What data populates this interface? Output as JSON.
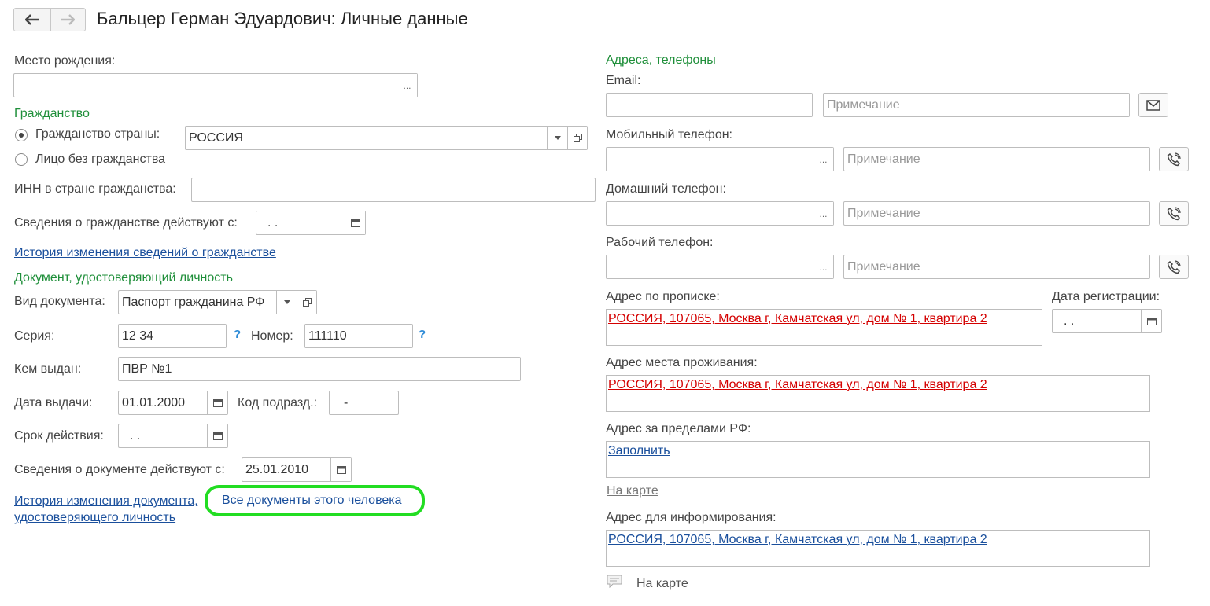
{
  "header": {
    "title": "Бальцер Герман Эдуардович: Личные данные"
  },
  "left": {
    "birthplace": {
      "label": "Место рождения:",
      "value": "",
      "select_btn": "..."
    },
    "citizenship_group": "Гражданство",
    "citizenship": {
      "option_country": "Гражданство страны:",
      "option_none": "Лицо без гражданства",
      "country_value": "РОССИЯ"
    },
    "inn": {
      "label": "ИНН в стране гражданства:",
      "value": ""
    },
    "citizenship_since": {
      "label": "Сведения о гражданстве действуют с:",
      "value": " .  ."
    },
    "citizenship_history_link": "История изменения сведений о гражданстве",
    "doc_group": "Документ, удостоверяющий личность",
    "doc_type": {
      "label": "Вид документа:",
      "value": "Паспорт гражданина РФ"
    },
    "series": {
      "label": "Серия:",
      "value": "12 34",
      "hint": "?"
    },
    "number": {
      "label": "Номер:",
      "value": "111110",
      "hint": "?"
    },
    "issued_by": {
      "label": "Кем выдан:",
      "value": "ПВР №1"
    },
    "issue_date": {
      "label": "Дата выдачи:",
      "value": "01.01.2000"
    },
    "dept_code": {
      "label": "Код подразд.:",
      "value": "-"
    },
    "valid_until": {
      "label": "Срок действия:",
      "value": " .  ."
    },
    "doc_since": {
      "label": "Сведения о документе действуют с:",
      "value": "25.01.2010"
    },
    "doc_history_link_1": "История изменения документа,",
    "doc_history_link_2": "удостоверяющего личность",
    "all_docs_link": "Все документы этого человека"
  },
  "right": {
    "group": "Адреса, телефоны",
    "email": {
      "label": "Email:",
      "value": "",
      "note_placeholder": "Примечание"
    },
    "mobile": {
      "label": "Мобильный телефон:",
      "value": "",
      "note_placeholder": "Примечание"
    },
    "home": {
      "label": "Домашний телефон:",
      "value": "",
      "note_placeholder": "Примечание"
    },
    "work": {
      "label": "Рабочий телефон:",
      "value": "",
      "note_placeholder": "Примечание"
    },
    "reg_address": {
      "label": "Адрес по прописке:",
      "value": "РОССИЯ, 107065, Москва г, Камчатская ул, дом № 1, квартира 2"
    },
    "reg_date": {
      "label": "Дата регистрации:",
      "value": " .  ."
    },
    "live_address": {
      "label": "Адрес места проживания:",
      "value": "РОССИЯ, 107065, Москва г, Камчатская ул, дом № 1, квартира 2"
    },
    "abroad_address": {
      "label": "Адрес за пределами РФ:",
      "value": "Заполнить"
    },
    "map_link_1": "На карте",
    "info_address": {
      "label": "Адрес для информирования:",
      "value": "РОССИЯ, 107065, Москва г, Камчатская ул, дом № 1, квартира 2"
    },
    "map_link_2": "На карте"
  },
  "colors": {
    "group_green": "#1f8f3a",
    "link_blue": "#1a4f9c",
    "address_red": "#d40000",
    "highlight": "#22dd22"
  }
}
